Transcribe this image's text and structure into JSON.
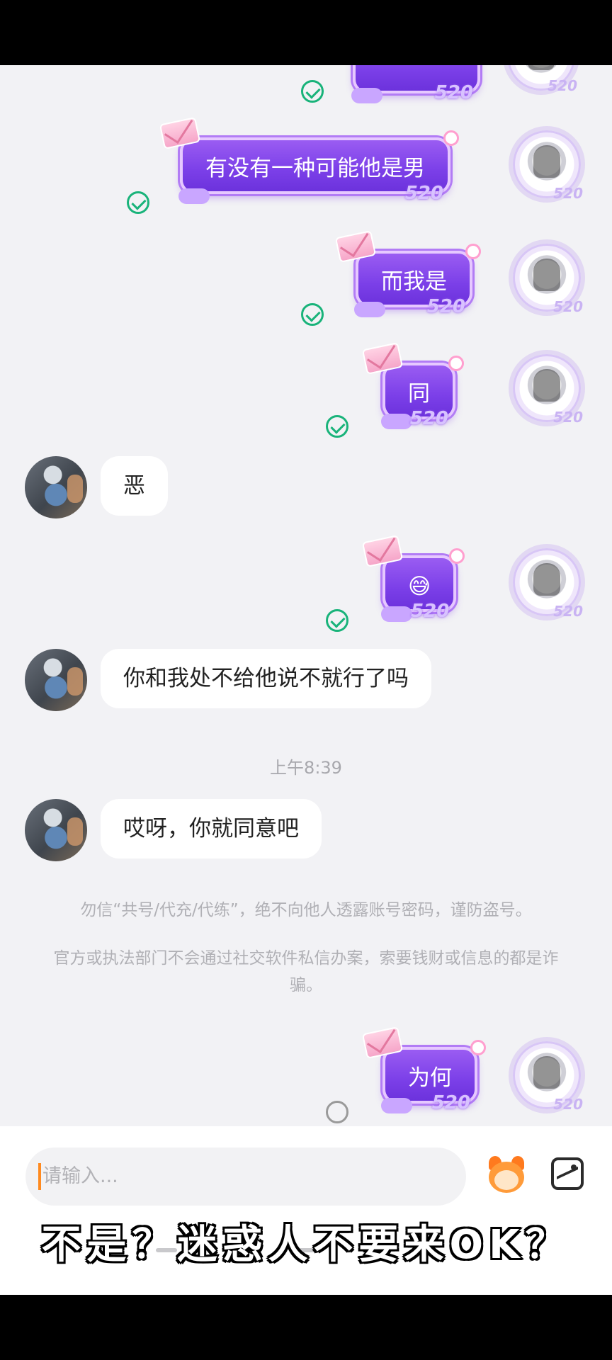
{
  "messages": [
    {
      "id": "m0",
      "direction": "out",
      "text": "",
      "status": "delivered"
    },
    {
      "id": "m1",
      "direction": "out",
      "text": "有没有一种可能他是男",
      "status": "delivered"
    },
    {
      "id": "m2",
      "direction": "out",
      "text": "而我是",
      "status": "delivered"
    },
    {
      "id": "m3",
      "direction": "out",
      "text": "同",
      "status": "delivered"
    },
    {
      "id": "m4",
      "direction": "in",
      "text": "恶"
    },
    {
      "id": "m5",
      "direction": "out",
      "text": "😅",
      "status": "delivered"
    },
    {
      "id": "m6",
      "direction": "in",
      "text": "你和我处不给他说不就行了吗"
    },
    {
      "id": "m7",
      "direction": "in",
      "text": "哎呀，你就同意吧"
    },
    {
      "id": "m8",
      "direction": "out",
      "text": "为何",
      "status": "sending"
    }
  ],
  "timestamp": "上午8:39",
  "notices": {
    "line1": "勿信“共号/代充/代练”，绝不向他人透露账号密码，谨防盗号。",
    "line2": "官方或执法部门不会通过社交软件私信办案，索要钱财或信息的都是诈骗。"
  },
  "bubble_tag": "520",
  "composer": {
    "placeholder": "请输入..."
  },
  "overlay_caption": "不是？迷惑人不要来OK？",
  "colors": {
    "bubble_out": "#7b3fe8",
    "check": "#19b37a",
    "caret": "#ff8a1f"
  },
  "icons": {
    "delivered": "check-circle-icon",
    "sending": "pending-circle-icon",
    "sticker": "sticker-icon",
    "image": "image-icon"
  }
}
